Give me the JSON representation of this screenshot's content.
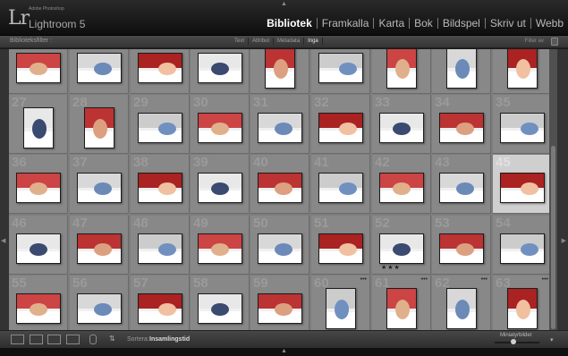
{
  "app": {
    "logo": "Lr",
    "subtitle": "Adobe Photoshop",
    "name": "Lightroom 5"
  },
  "modules": [
    {
      "label": "Bibliotek",
      "active": true
    },
    {
      "label": "Framkalla",
      "active": false
    },
    {
      "label": "Karta",
      "active": false
    },
    {
      "label": "Bok",
      "active": false
    },
    {
      "label": "Bildspel",
      "active": false
    },
    {
      "label": "Skriv ut",
      "active": false
    },
    {
      "label": "Webb",
      "active": false
    }
  ],
  "filterbar": {
    "title": "Biblioteksfilter :",
    "tabs": [
      {
        "label": "Text",
        "active": false
      },
      {
        "label": "Attribut",
        "active": false
      },
      {
        "label": "Metadata",
        "active": false
      },
      {
        "label": "Inga",
        "active": true
      }
    ],
    "filter_off": "Filter av"
  },
  "grid": {
    "rows": [
      {
        "numbers": [
          "",
          "",
          "",
          "",
          "",
          "",
          "",
          "",
          ""
        ]
      },
      {
        "numbers": [
          "27",
          "28",
          "29",
          "30",
          "31",
          "32",
          "33",
          "34",
          "35"
        ]
      },
      {
        "numbers": [
          "36",
          "37",
          "38",
          "39",
          "40",
          "41",
          "42",
          "43",
          "44",
          "45"
        ]
      },
      {
        "numbers": [
          "46",
          "47",
          "48",
          "49",
          "50",
          "51",
          "52",
          "53",
          "54"
        ]
      },
      {
        "numbers": [
          "55",
          "56",
          "57",
          "58",
          "59",
          "60",
          "61",
          "62",
          "63"
        ]
      }
    ],
    "selected_number": "45",
    "rated_number": "52",
    "rating_stars": "★★★"
  },
  "toolbar": {
    "sort_label": "Sortera:",
    "sort_value": "Insamlingstid",
    "thumb_size_label": "Miniatyrbilder",
    "thumb_size_level": 0.4
  },
  "colors": {
    "grid_bg": "#7d7d7d",
    "cell_bg": "#888888",
    "selected_bg": "#cfcfcf",
    "active_module": "#ffffff"
  },
  "icons": [
    "grid-view-icon",
    "loupe-view-icon",
    "compare-view-icon",
    "survey-view-icon",
    "painter-icon",
    "sort-direction-icon",
    "lock-icon"
  ]
}
